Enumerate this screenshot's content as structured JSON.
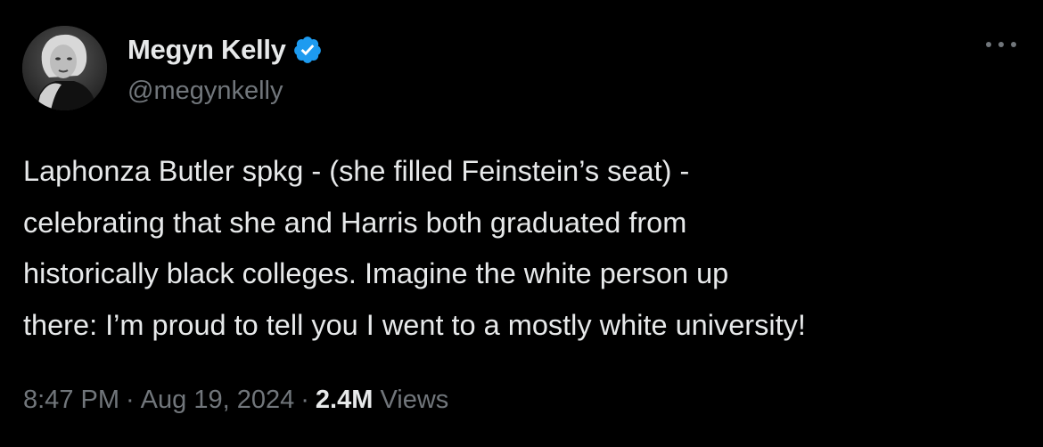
{
  "author": {
    "display_name": "Megyn Kelly",
    "handle": "@megynkelly",
    "verified_icon": "verified-badge-icon",
    "verified_color": "#1d9bf0"
  },
  "post": {
    "lines": [
      "Laphonza Butler spkg - (she filled Feinstein’s seat) -",
      "celebrating that she and Harris both graduated from",
      "historically black colleges. Imagine the white person up",
      "there: I’m proud to tell you I went to a mostly white university!"
    ]
  },
  "meta": {
    "time": "8:47 PM",
    "separator": "·",
    "date": "Aug 19, 2024",
    "views_count": "2.4M",
    "views_label": "Views"
  },
  "menu": {
    "icon": "more-options-icon"
  },
  "colors": {
    "background": "#000000",
    "primary_text": "#e7e9ea",
    "secondary_text": "#71767b"
  }
}
